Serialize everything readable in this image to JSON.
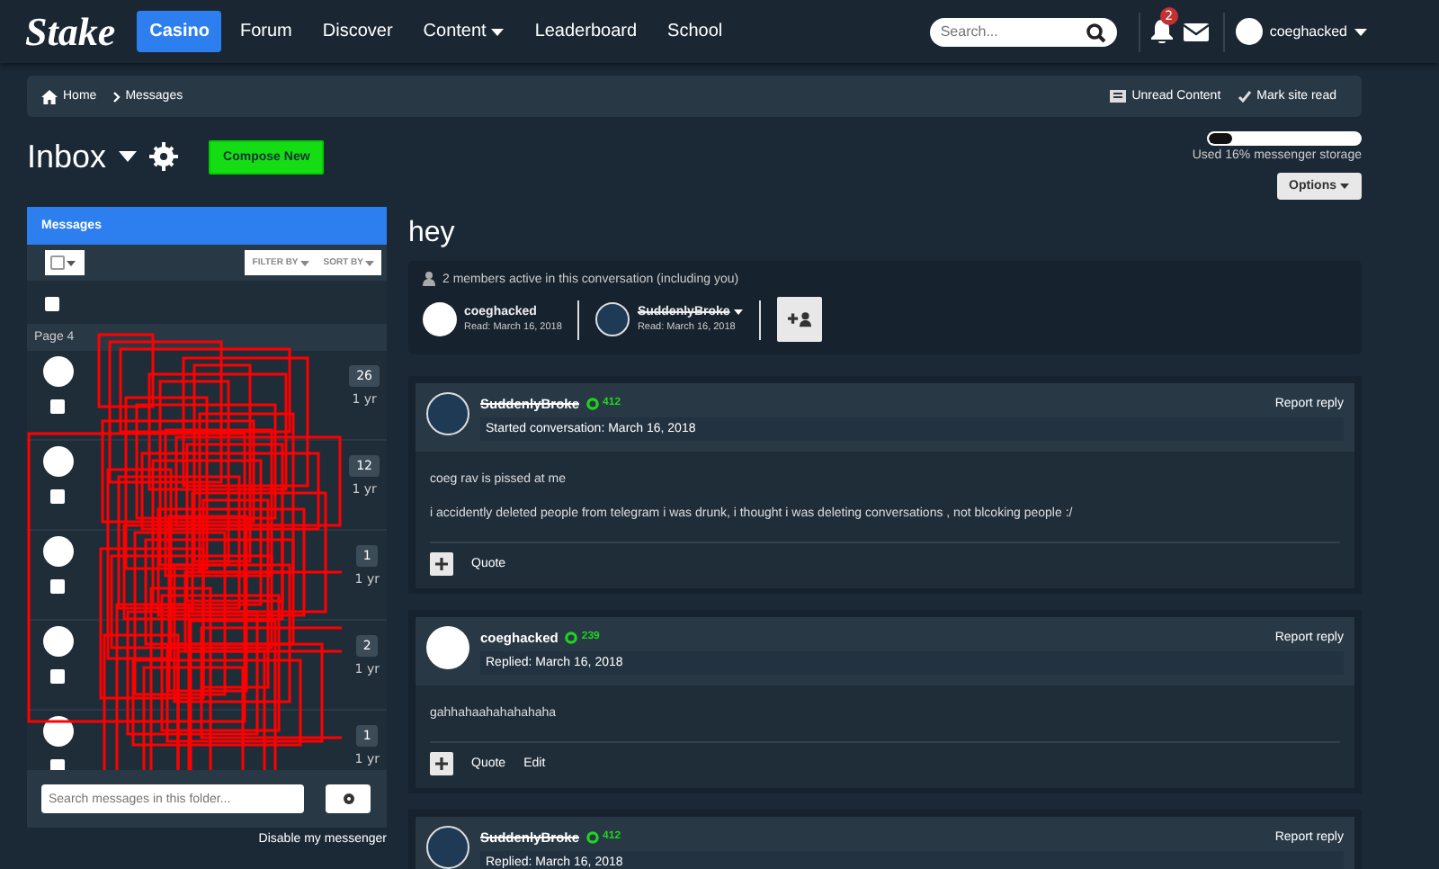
{
  "nav": {
    "logo": "Stake",
    "items": [
      {
        "label": "Casino",
        "selected": true,
        "caret": false
      },
      {
        "label": "Forum",
        "selected": false,
        "caret": false
      },
      {
        "label": "Discover",
        "selected": false,
        "caret": false
      },
      {
        "label": "Content",
        "selected": false,
        "caret": true
      },
      {
        "label": "Leaderboard",
        "selected": false,
        "caret": false
      },
      {
        "label": "School",
        "selected": false,
        "caret": false
      }
    ],
    "search_placeholder": "Search...",
    "notification_count": "2",
    "user": "coeghacked"
  },
  "breadcrumb": {
    "items": [
      "Home",
      "Messages"
    ],
    "links": [
      "Unread Content",
      "Mark site read"
    ]
  },
  "inbox": {
    "title": "Inbox",
    "compose": "Compose New",
    "storage": {
      "level": 0.16,
      "text": "Used 16% messenger storage"
    },
    "options": "Options"
  },
  "folder": {
    "header": "Messages",
    "select_all_checked": false,
    "filter": "FILTER BY",
    "sort": "SORT BY",
    "partial_row_checked": false,
    "page": "Page 4",
    "conversations": [
      {
        "count": "26",
        "time": "1 yr",
        "checked": false
      },
      {
        "count": "12",
        "time": "1 yr",
        "checked": false
      },
      {
        "count": "1",
        "time": "1 yr",
        "checked": false
      },
      {
        "count": "2",
        "time": "1 yr",
        "checked": false
      },
      {
        "count": "1",
        "time": "1 yr",
        "checked": false
      }
    ],
    "search_placeholder": "Search messages in this folder...",
    "footer": "Disable my messenger"
  },
  "conversation": {
    "title": "hey",
    "members_note": "2 members active in this conversation (including you)",
    "participants": [
      {
        "name": "coeghacked",
        "read": "Read: March 16, 2018",
        "struck": false,
        "menu": false
      },
      {
        "name": "SuddenlyBroke",
        "read": "Read: March 16, 2018",
        "struck": true,
        "menu": true
      }
    ],
    "posts": [
      {
        "author": "SuddenlyBroke",
        "struck": true,
        "points": "412",
        "meta": "Started conversation: March 16, 2018",
        "report": "Report reply",
        "body": [
          "coeg rav is pissed at me",
          "i accidently deleted people from telegram i was drunk, i thought i was deleting conversations , not blcoking people :/"
        ],
        "actions": [
          "Quote"
        ]
      },
      {
        "author": "coeghacked",
        "struck": false,
        "points": "239",
        "meta": "Replied: March 16, 2018",
        "report": "Report reply",
        "body": [
          "gahhahaahahahahaha"
        ],
        "actions": [
          "Quote",
          "Edit"
        ]
      },
      {
        "author": "SuddenlyBroke",
        "struck": true,
        "points": "412",
        "meta": "Replied: March 16, 2018",
        "report": "Report reply"
      }
    ]
  }
}
